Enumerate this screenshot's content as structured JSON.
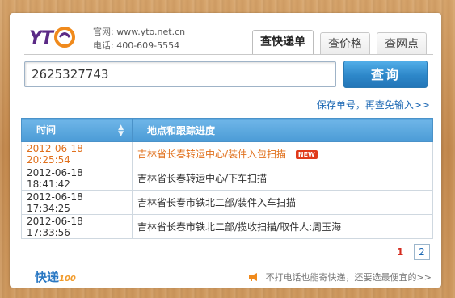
{
  "header": {
    "logo_text": "YTO",
    "contact": [
      {
        "label": "官网:",
        "value": "www.yto.net.cn"
      },
      {
        "label": "电话:",
        "value": "400-609-5554"
      }
    ]
  },
  "tabs": [
    {
      "label": "查快递单",
      "active": true
    },
    {
      "label": "查价格",
      "active": false
    },
    {
      "label": "查网点",
      "active": false
    }
  ],
  "search": {
    "value": "2625327743",
    "button_label": "查询",
    "save_link": "保存单号，再查免输入>>"
  },
  "table": {
    "headers": [
      "时间",
      "地点和跟踪进度"
    ],
    "rows": [
      {
        "time": "2012-06-18 20:25:54",
        "event": "吉林省长春转运中心/装件入包扫描",
        "badge": "NEW"
      },
      {
        "time": "2012-06-18 18:41:42",
        "event": "吉林省长春转运中心/下车扫描"
      },
      {
        "time": "2012-06-18 17:34:25",
        "event": "吉林省长春市铁北二部/装件入车扫描"
      },
      {
        "time": "2012-06-18 17:33:56",
        "event": "吉林省长春市铁北二部/揽收扫描/取件人:周玉海"
      }
    ]
  },
  "pagination": {
    "current": "1",
    "other": "2"
  },
  "footer": {
    "logo_text": "快递",
    "logo_sub": "100",
    "promo_link": "不打电话也能寄快递，还要选最便宜的>>"
  },
  "colors": {
    "brand_blue": "#2a78c3",
    "accent_orange": "#e0701c",
    "header_blue": "#5aa7de"
  }
}
